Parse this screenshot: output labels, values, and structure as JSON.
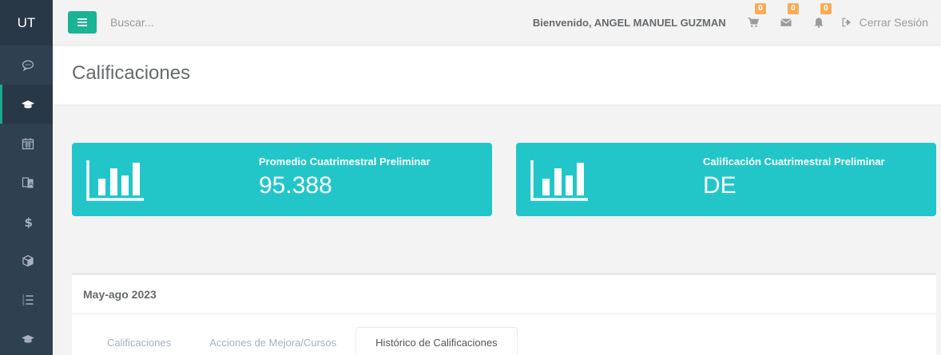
{
  "sidebar": {
    "brand": "UT",
    "items": [
      {
        "icon": "chat-icon",
        "active": false
      },
      {
        "icon": "graduation-cap-icon",
        "active": true
      },
      {
        "icon": "calendar-icon",
        "active": false
      },
      {
        "icon": "translate-book-icon",
        "active": false
      },
      {
        "icon": "dollar-icon",
        "active": false
      },
      {
        "icon": "cube-icon",
        "active": false
      },
      {
        "icon": "list-icon",
        "active": false
      },
      {
        "icon": "graduation-cap-icon",
        "active": false
      }
    ]
  },
  "topbar": {
    "search_placeholder": "Buscar...",
    "welcome": "Bienvenido, ANGEL MANUEL GUZMAN",
    "cart_count": "0",
    "mail_count": "0",
    "bell_count": "0",
    "logout_label": "Cerrar Sesión"
  },
  "page": {
    "title": "Calificaciones"
  },
  "widgets": [
    {
      "label": "Promedio Cuatrimestral Preliminar",
      "value": "95.388",
      "icon": "bar-chart-icon"
    },
    {
      "label": "Calificación Cuatrimestral Preliminar",
      "value": "DE",
      "icon": "bar-chart-icon"
    }
  ],
  "panel": {
    "title": "May-ago 2023",
    "tabs": [
      {
        "label": "Calificaciones",
        "active": false
      },
      {
        "label": "Acciones de Mejora/Cursos",
        "active": false
      },
      {
        "label": "Histórico de Calificaciones",
        "active": true
      }
    ]
  },
  "colors": {
    "sidebar_bg": "#2f4050",
    "accent": "#1ab394",
    "widget_bg": "#23c6c8",
    "badge": "#f8ac59"
  }
}
